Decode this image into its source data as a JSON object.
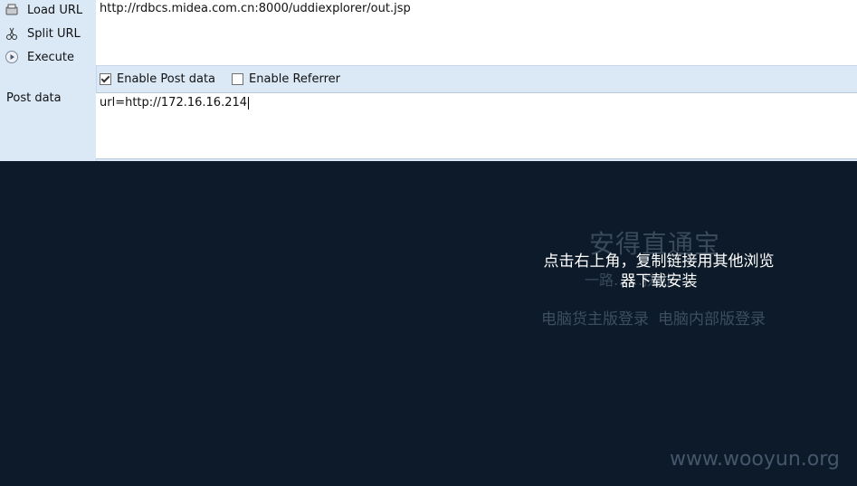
{
  "toolbar": {
    "load_url": "Load URL",
    "split_url": "Split URL",
    "execute": "Execute",
    "url_value": "http://rdbcs.midea.com.cn:8000/uddiexplorer/out.jsp",
    "enable_post": "Enable Post data",
    "enable_post_checked": true,
    "enable_referrer": "Enable Referrer",
    "enable_referrer_checked": false,
    "post_label": "Post data",
    "post_value": "url=http://172.16.16.214"
  },
  "page": {
    "brand_title": "安得直通宝",
    "slogan": "一路……扶付",
    "overlay_message": "点击右上角，复制链接用其他浏览器下载安装",
    "link_owner": "电脑货主版登录",
    "link_internal": "电脑内部版登录",
    "watermark": "www.wooyun.org"
  },
  "colors": {
    "toolbar_bg": "#dbe9f7",
    "viewport_bg": "#0c1a2a"
  }
}
